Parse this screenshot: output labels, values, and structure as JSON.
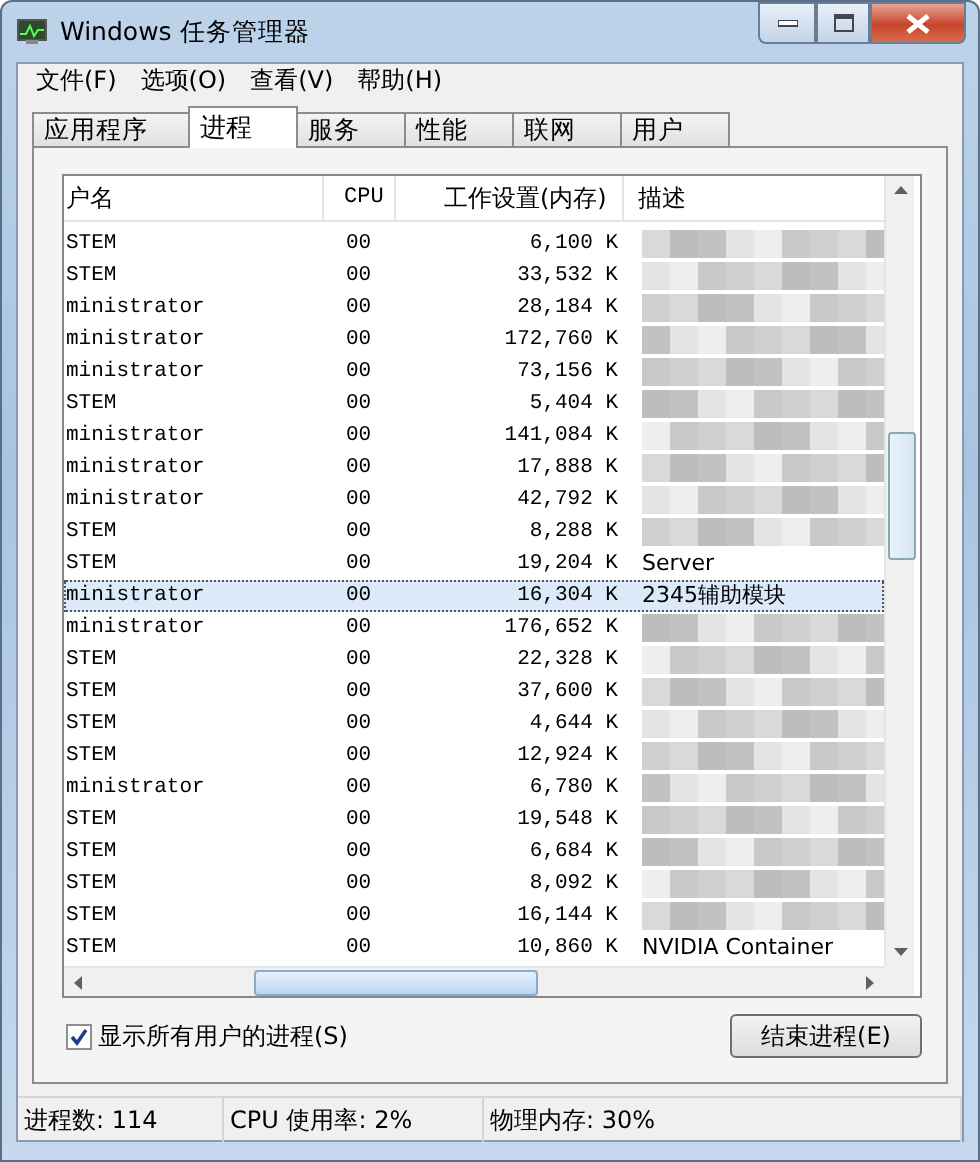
{
  "window": {
    "title": "Windows 任务管理器"
  },
  "menu": [
    "文件(F)",
    "选项(O)",
    "查看(V)",
    "帮助(H)"
  ],
  "tabs": [
    {
      "label": "应用程序",
      "selected": false
    },
    {
      "label": "进程",
      "selected": true
    },
    {
      "label": "服务",
      "selected": false
    },
    {
      "label": "性能",
      "selected": false
    },
    {
      "label": "联网",
      "selected": false
    },
    {
      "label": "用户",
      "selected": false
    }
  ],
  "table": {
    "columns": [
      "户名",
      "CPU",
      "工作设置(内存)",
      "描述"
    ],
    "rows": [
      {
        "user": "STEM",
        "cpu": "00",
        "memory": "6,100 K",
        "redacted": true,
        "selected": false
      },
      {
        "user": "STEM",
        "cpu": "00",
        "memory": "33,532 K",
        "redacted": true,
        "selected": false
      },
      {
        "user": "ministrator",
        "cpu": "00",
        "memory": "28,184 K",
        "redacted": true,
        "selected": false
      },
      {
        "user": "ministrator",
        "cpu": "00",
        "memory": "172,760 K",
        "redacted": true,
        "selected": false
      },
      {
        "user": "ministrator",
        "cpu": "00",
        "memory": "73,156 K",
        "redacted": true,
        "selected": false
      },
      {
        "user": "STEM",
        "cpu": "00",
        "memory": "5,404 K",
        "redacted": true,
        "selected": false
      },
      {
        "user": "ministrator",
        "cpu": "00",
        "memory": "141,084 K",
        "redacted": true,
        "selected": false
      },
      {
        "user": "ministrator",
        "cpu": "00",
        "memory": "17,888 K",
        "redacted": true,
        "selected": false
      },
      {
        "user": "ministrator",
        "cpu": "00",
        "memory": "42,792 K",
        "redacted": true,
        "selected": false
      },
      {
        "user": "STEM",
        "cpu": "00",
        "memory": "8,288 K",
        "redacted": true,
        "selected": false
      },
      {
        "user": "STEM",
        "cpu": "00",
        "memory": "19,204 K",
        "description": "Server",
        "redacted": false,
        "selected": false
      },
      {
        "user": "ministrator",
        "cpu": "00",
        "memory": "16,304 K",
        "description": "2345辅助模块",
        "redacted": false,
        "selected": true
      },
      {
        "user": "ministrator",
        "cpu": "00",
        "memory": "176,652 K",
        "redacted": true,
        "selected": false
      },
      {
        "user": "STEM",
        "cpu": "00",
        "memory": "22,328 K",
        "redacted": true,
        "selected": false
      },
      {
        "user": "STEM",
        "cpu": "00",
        "memory": "37,600 K",
        "redacted": true,
        "selected": false
      },
      {
        "user": "STEM",
        "cpu": "00",
        "memory": "4,644 K",
        "redacted": true,
        "selected": false
      },
      {
        "user": "STEM",
        "cpu": "00",
        "memory": "12,924 K",
        "redacted": true,
        "selected": false
      },
      {
        "user": "ministrator",
        "cpu": "00",
        "memory": "6,780 K",
        "redacted": true,
        "selected": false
      },
      {
        "user": "STEM",
        "cpu": "00",
        "memory": "19,548 K",
        "redacted": true,
        "selected": false
      },
      {
        "user": "STEM",
        "cpu": "00",
        "memory": "6,684 K",
        "redacted": true,
        "selected": false
      },
      {
        "user": "STEM",
        "cpu": "00",
        "memory": "8,092 K",
        "redacted": true,
        "selected": false
      },
      {
        "user": "STEM",
        "cpu": "00",
        "memory": "16,144 K",
        "redacted": true,
        "selected": false
      },
      {
        "user": "STEM",
        "cpu": "00",
        "memory": "10,860 K",
        "description": "NVIDIA Container",
        "redacted": false,
        "selected": false
      }
    ]
  },
  "show_all_users": {
    "label": "显示所有用户的进程(S)",
    "checked": true
  },
  "end_button": "结束进程(E)",
  "status_bar": [
    "进程数: 114",
    "CPU 使用率: 2%",
    "物理内存: 30%"
  ]
}
